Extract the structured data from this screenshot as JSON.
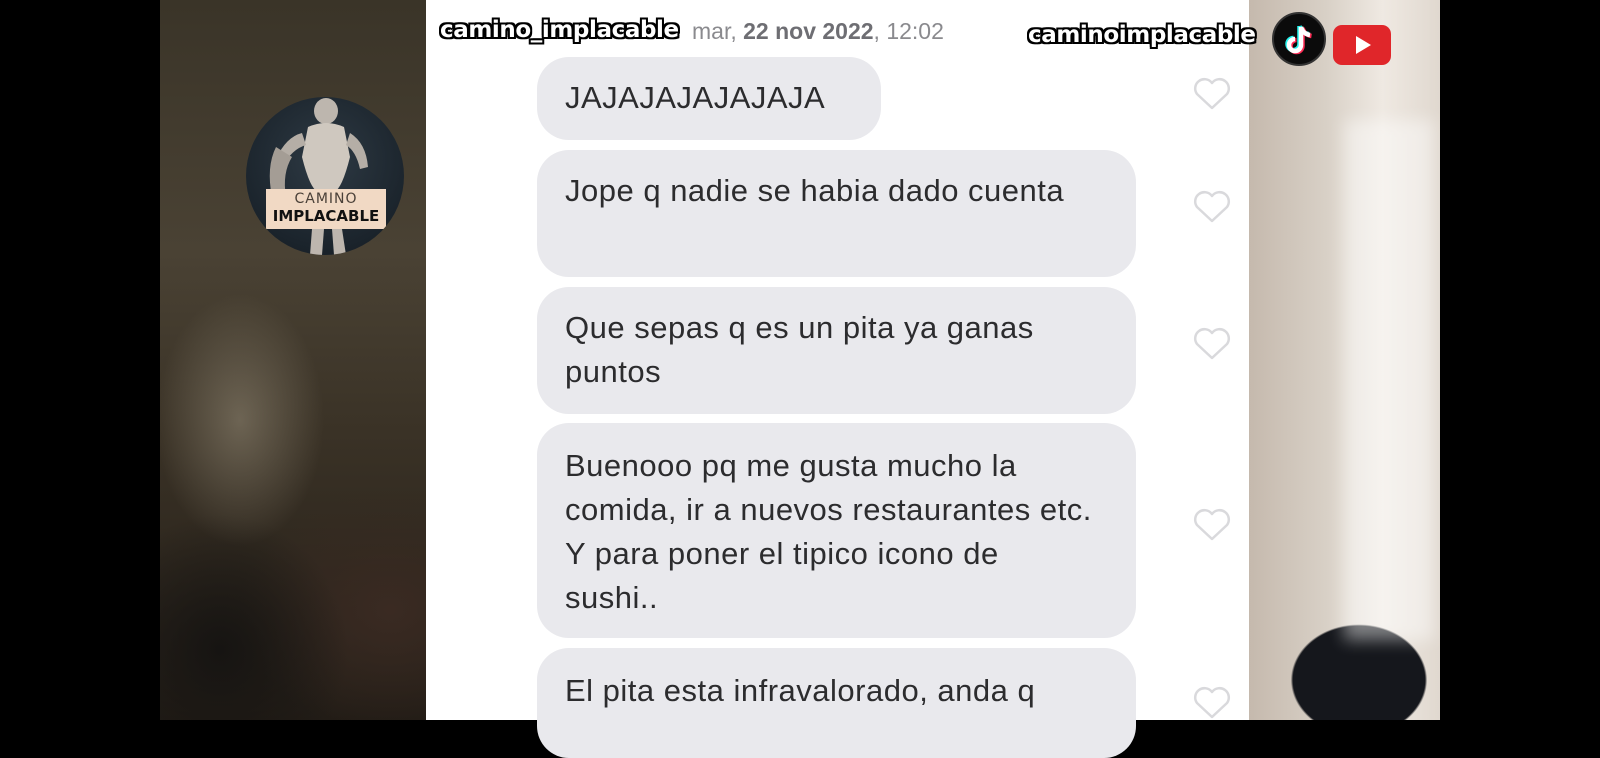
{
  "overlay": {
    "handle_left": "camino_implacable",
    "handle_right": "caminoimplacable",
    "logo_line1": "CAMINO",
    "logo_line2": "IMPLACABLE"
  },
  "chat": {
    "timestamp_day": "mar,",
    "timestamp_date": "22 nov 2022",
    "timestamp_time": ", 12:02",
    "messages": [
      {
        "text": "JAJAJAJAJAJAJA"
      },
      {
        "text": "Jope q nadie se habia dado cuenta"
      },
      {
        "text": "Que sepas q es un pita ya ganas puntos"
      },
      {
        "text": "Buenooo pq me gusta mucho la comida, ir a nuevos restaurantes etc. Y para poner el tipico icono de sushi.."
      },
      {
        "text": "El pita esta infravalorado, anda q"
      }
    ]
  },
  "colors": {
    "bubble": "#e9e9ed",
    "heart_outline": "#d9d9dc",
    "tiktok": "#0b0b0b",
    "youtube": "#e0262a"
  },
  "icons": [
    "heart-icon",
    "tiktok-icon",
    "youtube-icon"
  ]
}
